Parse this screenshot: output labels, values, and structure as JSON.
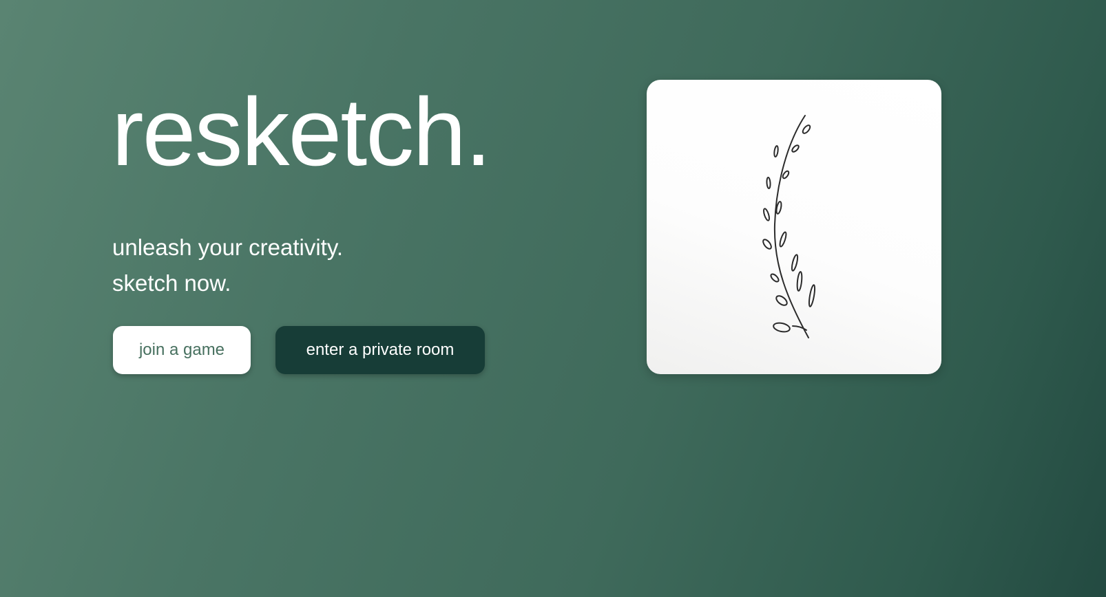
{
  "hero": {
    "title": "resketch.",
    "tagline_line1": "unleash your creativity.",
    "tagline_line2": "sketch now."
  },
  "actions": {
    "join_label": "join a game",
    "private_label": "enter a private room"
  },
  "illustration": {
    "icon": "leaf-branch-sketch-icon"
  },
  "colors": {
    "background_start": "#5a8472",
    "background_end": "#234a41",
    "primary_button": "#173d37",
    "secondary_button_text": "#47705f"
  }
}
